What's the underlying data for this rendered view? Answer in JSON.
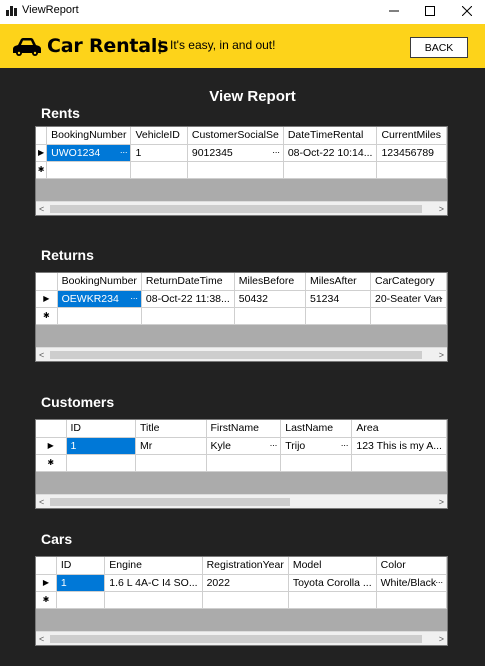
{
  "window": {
    "title": "ViewReport"
  },
  "header": {
    "brand": "Car Rentals",
    "divider": "|",
    "tagline": "It's easy, in and out!",
    "back_label": "BACK"
  },
  "page": {
    "title": "View Report"
  },
  "sections": [
    {
      "title": "Rents",
      "columns": [
        "BookingNumber",
        "VehicleID",
        "CustomerSocialSe",
        "DateTimeRental",
        "CurrentMiles"
      ],
      "row": [
        "UWO1234",
        "1",
        "9012345",
        "08-Oct-22 10:14...",
        "123456789"
      ]
    },
    {
      "title": "Returns",
      "columns": [
        "BookingNumber",
        "ReturnDateTime",
        "MilesBefore",
        "MilesAfter",
        "CarCategory"
      ],
      "row": [
        "OEWKR234",
        "08-Oct-22 11:38...",
        "50432",
        "51234",
        "20-Seater Van"
      ]
    },
    {
      "title": "Customers",
      "columns": [
        "ID",
        "Title",
        "FirstName",
        "LastName",
        "Area"
      ],
      "row": [
        "1",
        "Mr",
        "Kyle",
        "Trijo",
        "123 This is my A..."
      ]
    },
    {
      "title": "Cars",
      "columns": [
        "ID",
        "Engine",
        "RegistrationYear",
        "Model",
        "Color"
      ],
      "row": [
        "1",
        "1.6 L 4A-C I4 SO...",
        "2022",
        "Toyota Corolla ...",
        "White/Black"
      ]
    }
  ],
  "grid_glyphs": {
    "current_row": "▶",
    "new_row": "✱",
    "scroll_left": "<",
    "scroll_right": ">",
    "ellipsis": "..."
  },
  "colors": {
    "header_yellow": "#fdd31a",
    "main_bg": "#222222",
    "selection": "#0078d7"
  }
}
